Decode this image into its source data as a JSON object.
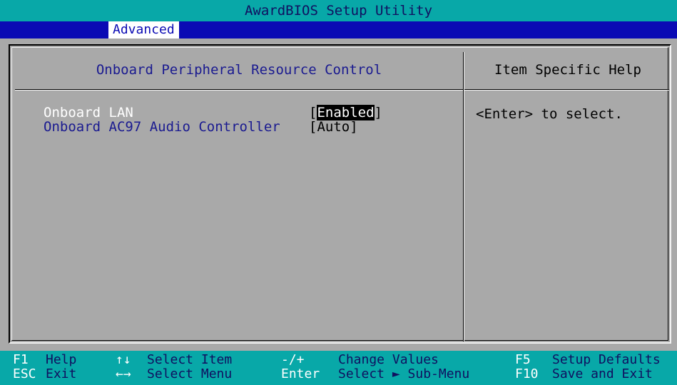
{
  "title": "AwardBIOS Setup Utility",
  "menu": {
    "active_tab": "Advanced"
  },
  "panel": {
    "title": "Onboard Peripheral Resource Control",
    "help_title": "Item Specific Help",
    "help_text": "<Enter> to select."
  },
  "options": [
    {
      "label": "Onboard LAN",
      "value": "Enabled"
    },
    {
      "label": "Onboard AC97 Audio Controller",
      "value": "Auto"
    }
  ],
  "footer": {
    "keys": [
      {
        "key": "F1",
        "desc": "Help"
      },
      {
        "key": "ESC",
        "desc": "Exit"
      },
      {
        "key": "↑↓",
        "desc": "Select Item"
      },
      {
        "key": "←→",
        "desc": "Select Menu"
      },
      {
        "key": "-/+",
        "desc": "Change Values"
      },
      {
        "key": "Enter",
        "desc": "Select ► Sub-Menu"
      },
      {
        "key": "F5",
        "desc": "Setup Defaults"
      },
      {
        "key": "F10",
        "desc": "Save and Exit"
      }
    ]
  },
  "colors": {
    "title_bg": "#08a8a8",
    "menu_bg": "#0a0ab4",
    "panel_bg": "#a9a9a9",
    "label_selected": "#ffffff",
    "label_normal": "#1a1a90"
  }
}
